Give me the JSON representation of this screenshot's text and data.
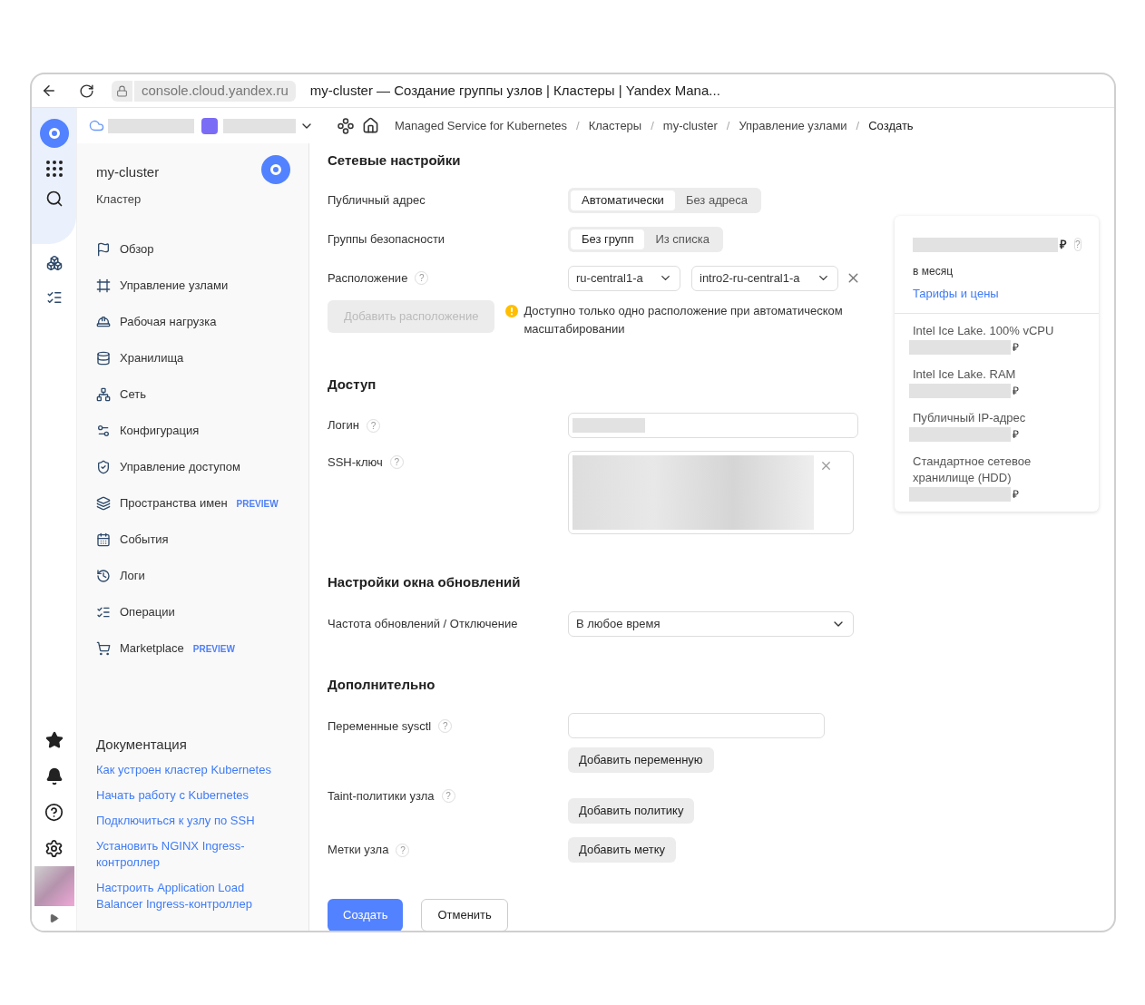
{
  "browser": {
    "url": "console.cloud.yandex.ru",
    "tab_title": "my-cluster — Создание группы узлов | Кластеры | Yandex Mana..."
  },
  "breadcrumbs": [
    {
      "label": "Managed Service for Kubernetes"
    },
    {
      "separator": "/",
      "label": "Кластеры"
    },
    {
      "separator": "/",
      "label": "my-cluster"
    },
    {
      "separator": "/",
      "label": "Управление узлами"
    },
    {
      "separator": "/",
      "label": "Создать"
    }
  ],
  "cluster": {
    "name": "my-cluster",
    "type": "Кластер"
  },
  "nav": [
    {
      "label": "Обзор"
    },
    {
      "label": "Управление узлами"
    },
    {
      "label": "Рабочая нагрузка"
    },
    {
      "label": "Хранилища"
    },
    {
      "label": "Сеть"
    },
    {
      "label": "Конфигурация"
    },
    {
      "label": "Управление доступом"
    },
    {
      "label": "Пространства имен",
      "badge": "PREVIEW"
    },
    {
      "label": "События"
    },
    {
      "label": "Логи"
    },
    {
      "label": "Операции"
    },
    {
      "label": "Marketplace",
      "badge": "PREVIEW"
    }
  ],
  "docs": {
    "title": "Документация",
    "links": [
      "Как устроен кластер Kubernetes",
      "Начать работу с Kubernetes",
      "Подключиться к узлу по SSH",
      "Установить NGINX Ingress-контроллер",
      "Настроить Application Load Balancer Ingress-контроллер"
    ]
  },
  "network": {
    "title": "Сетевые настройки",
    "public_address": {
      "label": "Публичный адрес",
      "options": [
        {
          "label": "Автоматически",
          "selected": true
        },
        {
          "label": "Без адреса",
          "selected": false
        }
      ]
    },
    "security_groups": {
      "label": "Группы безопасности",
      "options": [
        {
          "label": "Без групп",
          "selected": true
        },
        {
          "label": "Из списка",
          "selected": false
        }
      ]
    },
    "location": {
      "label": "Расположение",
      "help": "?",
      "zones": [
        "ru-central1-a",
        "intro2-ru-central1-a"
      ]
    },
    "add_location": {
      "label": "Добавить расположение",
      "disabled": true
    },
    "warning": "Доступно только одно расположение при автоматическом масштабировании"
  },
  "access": {
    "title": "Доступ",
    "login": {
      "label": "Логин",
      "help": "?"
    },
    "ssh_key": {
      "label": "SSH-ключ",
      "help": "?"
    }
  },
  "maintenance": {
    "title": "Настройки окна обновлений",
    "frequency": {
      "label": "Частота обновлений / Отключение",
      "value": "В любое время"
    }
  },
  "extra": {
    "title": "Дополнительно",
    "sysctl": {
      "label": "Переменные sysctl",
      "help": "?",
      "button": "Добавить переменную"
    },
    "taints": {
      "label": "Taint-политики узла",
      "help": "?",
      "button": "Добавить политику"
    },
    "node_labels": {
      "label": "Метки узла",
      "help": "?",
      "button": "Добавить метку"
    }
  },
  "actions": [
    {
      "label": "Создать",
      "primary": true
    },
    {
      "label": "Отменить",
      "primary": false
    }
  ],
  "pricing": {
    "currency": "₽",
    "help": "?",
    "period": "в месяц",
    "link": "Тарифы и цены",
    "items": [
      {
        "label": "Intel Ice Lake. 100% vCPU",
        "currency": "₽"
      },
      {
        "label": "Intel Ice Lake. RAM",
        "currency": "₽"
      },
      {
        "label": "Публичный IP-адрес",
        "currency": "₽"
      },
      {
        "label": "Стандартное сетевое хранилище (HDD)",
        "currency": "₽"
      }
    ]
  }
}
